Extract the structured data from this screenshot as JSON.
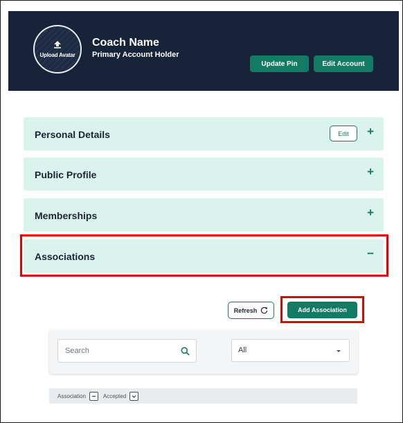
{
  "profile": {
    "avatar_label": "Upload Avatar",
    "name": "Coach Name",
    "role": "Primary Account Holder",
    "update_pin_label": "Update Pin",
    "edit_account_label": "Edit Account"
  },
  "panels": [
    {
      "title": "Personal Details",
      "toggle": "+",
      "edit_label": "Edit"
    },
    {
      "title": "Public Profile",
      "toggle": "+"
    },
    {
      "title": "Memberships",
      "toggle": "+"
    },
    {
      "title": "Associations",
      "toggle": "−"
    }
  ],
  "associations": {
    "refresh_label": "Refresh",
    "add_label": "Add Association",
    "search_placeholder": "Search",
    "select_value": "All",
    "columns": [
      {
        "label": "Association",
        "toggle_icon": "minus-icon"
      },
      {
        "label": "Accepted",
        "toggle_icon": "chevron-down-icon"
      }
    ]
  },
  "colors": {
    "header_bg": "#172339",
    "accent_green": "#137a63",
    "panel_bg": "#daf3ec",
    "highlight_red": "#e50000"
  }
}
